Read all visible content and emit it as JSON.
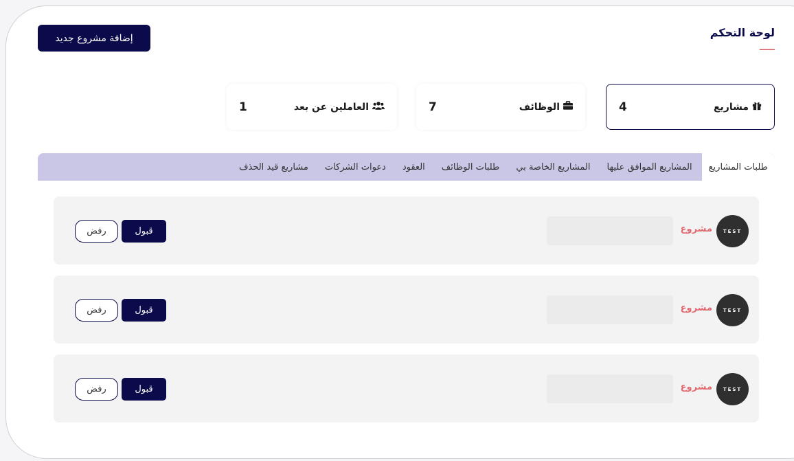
{
  "header": {
    "title": "لوحة التحكم",
    "add_button": "إضافة مشروع جديد"
  },
  "stats": [
    {
      "label": "مشاريع",
      "value": "4",
      "icon": "gift-icon",
      "active": true
    },
    {
      "label": "الوظائف",
      "value": "7",
      "icon": "briefcase-icon",
      "active": false
    },
    {
      "label": "العاملين عن بعد",
      "value": "1",
      "icon": "users-icon",
      "active": false
    }
  ],
  "tabs": [
    {
      "label": "طلبات المشاريع",
      "active": true
    },
    {
      "label": "المشاريع الموافق عليها"
    },
    {
      "label": "المشاريع الخاصة بي"
    },
    {
      "label": "طلبات الوظائف"
    },
    {
      "label": "العقود"
    },
    {
      "label": "دعوات الشركات"
    },
    {
      "label": "مشاريع قيد الحذف"
    }
  ],
  "requests": [
    {
      "avatar_text": "TEST",
      "label": "مشروع",
      "accept": "قبول",
      "reject": "رفض"
    },
    {
      "avatar_text": "TEST",
      "label": "مشروع",
      "accept": "قبول",
      "reject": "رفض"
    },
    {
      "avatar_text": "TEST",
      "label": "مشروع",
      "accept": "قبول",
      "reject": "رفض"
    }
  ],
  "colors": {
    "primary": "#0b0a4a",
    "accent": "#e06a6f",
    "tabs_bg": "#c9c6e6"
  }
}
